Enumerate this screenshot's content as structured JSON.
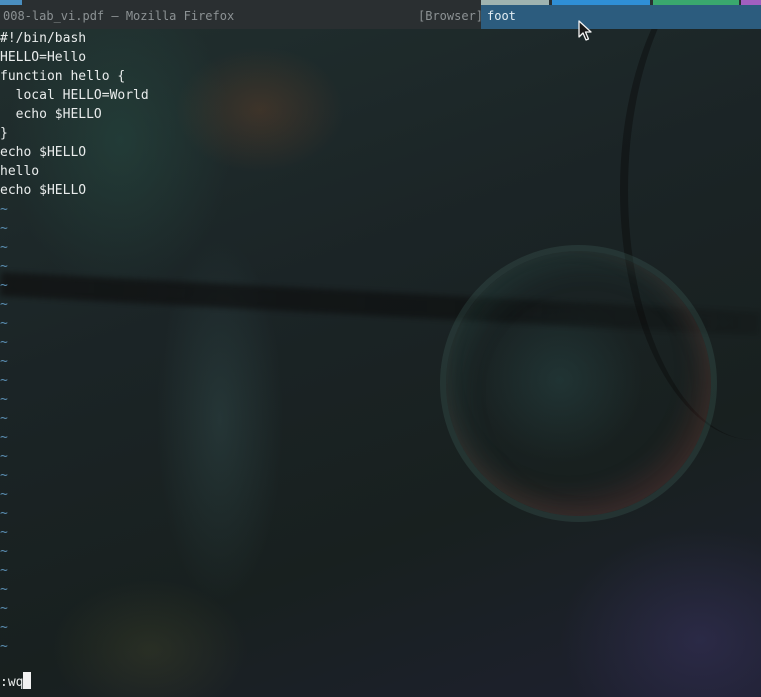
{
  "topbar": {
    "window_title": "008-lab_vi.pdf — Mozilla Firefox",
    "window_app_tag": "[Browser]",
    "focused_window_title": "foot",
    "accent_colors": [
      "#4a8fc0",
      "#9fb3b0",
      "#2f8fd6",
      "#3aa86e",
      "#a25fc0"
    ],
    "focused_color": "#2c5c7e"
  },
  "editor": {
    "lines": [
      "#!/bin/bash",
      "HELLO=Hello",
      "function hello {",
      "  local HELLO=World",
      "  echo $HELLO",
      "}",
      "echo $HELLO",
      "hello",
      "echo $HELLO"
    ],
    "empty_line_marker": "~",
    "empty_line_color": "#5b8fb4",
    "command_line": ":wq"
  }
}
